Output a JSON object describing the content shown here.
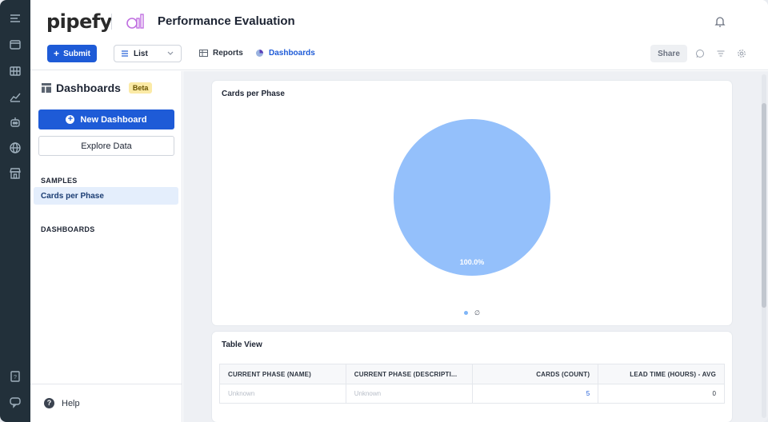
{
  "app": {
    "logo": "pipefy",
    "pipe_title": "Performance Evaluation",
    "accent": "#1e5bd7"
  },
  "toolbar": {
    "submit_label": "Submit",
    "view_select": "List",
    "tabs": [
      {
        "label": "Reports",
        "icon": "table-icon"
      },
      {
        "label": "Dashboards",
        "icon": "dashboard-icon"
      }
    ],
    "share_label": "Share"
  },
  "sidebar": {
    "title": "Dashboards",
    "badge": "Beta",
    "new_dashboard_label": "New Dashboard",
    "explore_label": "Explore Data",
    "samples_heading": "SAMPLES",
    "samples": [
      {
        "label": "Cards per Phase"
      }
    ],
    "dashboards_heading": "DASHBOARDS",
    "help_label": "Help"
  },
  "chart_data": {
    "type": "pie",
    "title": "Cards per Phase",
    "slices": [
      {
        "label": "∅",
        "value": 100.0,
        "color": "#94c0fb"
      }
    ],
    "data_label": "100.0%",
    "legend_placement": "bottom"
  },
  "table": {
    "title": "Table View",
    "columns": [
      "CURRENT PHASE (NAME)",
      "CURRENT PHASE (DESCRIPTI...",
      "CARDS (COUNT)",
      "LEAD TIME (HOURS) - AVG"
    ],
    "rows": [
      [
        "Unknown",
        "Unknown",
        "5",
        "0"
      ]
    ]
  }
}
